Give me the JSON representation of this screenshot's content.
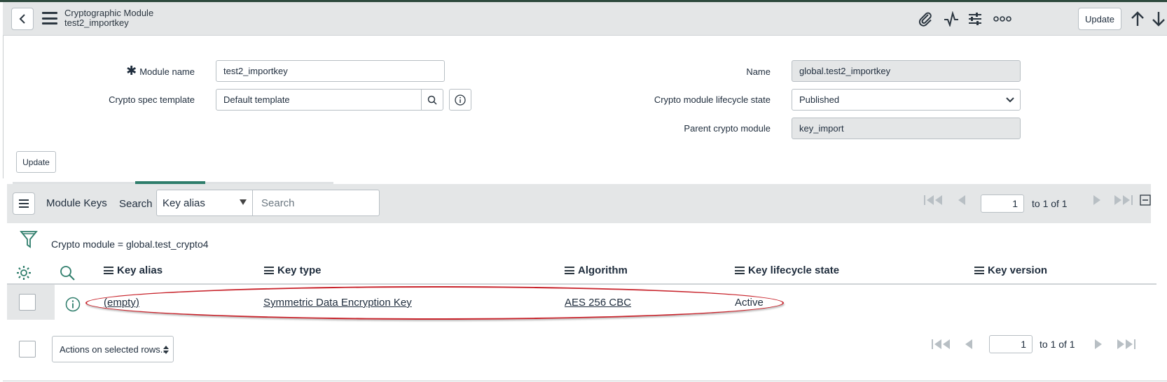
{
  "header": {
    "title": "Cryptographic Module",
    "subtitle": "test2_importkey",
    "update_label": "Update",
    "icons": [
      "back-icon",
      "menu-icon",
      "paperclip-icon",
      "activity-icon",
      "settings-sliders-icon",
      "more-icon",
      "arrow-up-icon",
      "arrow-down-icon"
    ]
  },
  "form": {
    "module_name_label": "Module name",
    "module_name_value": "test2_importkey",
    "crypto_spec_label": "Crypto spec template",
    "crypto_spec_value": "Default template",
    "name_label": "Name",
    "name_value": "global.test2_importkey",
    "lifecycle_label": "Crypto module lifecycle state",
    "lifecycle_value": "Published",
    "parent_label": "Parent crypto module",
    "parent_value": "key_import",
    "update_label": "Update"
  },
  "list": {
    "title": "Module Keys",
    "search_label": "Search",
    "search_field": "Key alias",
    "search_placeholder": "Search",
    "page_value": "1",
    "page_text": "to 1 of 1",
    "filter_text": "Crypto module = global.test_crypto4",
    "columns": [
      "Key alias",
      "Key type",
      "Algorithm",
      "Key lifecycle state",
      "Key version"
    ],
    "rows": [
      {
        "key_alias": "(empty)",
        "key_type": "Symmetric Data Encryption Key",
        "algorithm": "AES 256 CBC",
        "lifecycle": "Active",
        "version": ""
      }
    ],
    "actions_label": "Actions on selected rows...",
    "bottom_page_value": "1",
    "bottom_page_text": "to 1 of 1"
  },
  "colors": {
    "accent": "#2e7d6b",
    "highlight_oval": "#c8232b",
    "header_bg": "#e4e6e7"
  }
}
